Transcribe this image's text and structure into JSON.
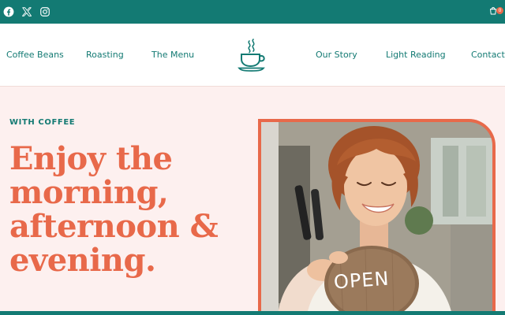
{
  "topbar": {
    "social": [
      {
        "name": "facebook",
        "icon": "facebook-icon"
      },
      {
        "name": "x",
        "icon": "x-icon"
      },
      {
        "name": "instagram",
        "icon": "instagram-icon"
      }
    ],
    "cart": {
      "icon": "cart-icon",
      "count": "0"
    }
  },
  "nav": {
    "left": [
      "Coffee Beans",
      "Roasting",
      "The Menu"
    ],
    "right": [
      "Our Story",
      "Light Reading",
      "Contact"
    ],
    "logo_icon": "coffee-cup-icon"
  },
  "hero": {
    "eyebrow": "WITH COFFEE",
    "headline_lines": [
      "Enjoy the",
      "morning,",
      "afternoon &",
      "evening."
    ],
    "sign_text": "OPEN"
  },
  "colors": {
    "teal": "#137a73",
    "coral": "#e8694a",
    "background": "#fdf0ef"
  }
}
